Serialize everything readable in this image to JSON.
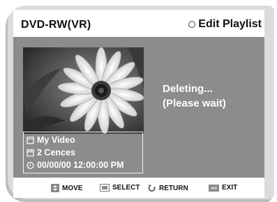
{
  "header": {
    "device": "DVD-RW(VR)",
    "menu_icon": "circle-icon",
    "menu_title": "Edit Playlist"
  },
  "info": {
    "title": "My Video",
    "title_icon": "title-icon",
    "scenes": "2 Cences",
    "scenes_icon": "scene-icon",
    "datetime": "00/00/00 12:00:00  PM",
    "datetime_icon": "clock-icon"
  },
  "status": {
    "line1": "Deleting...",
    "line2": "(Please wait)"
  },
  "footer": {
    "move_label": "MOVE",
    "select_label": "SELECT",
    "return_label": "RETURN",
    "exit_label": "EXIT"
  }
}
